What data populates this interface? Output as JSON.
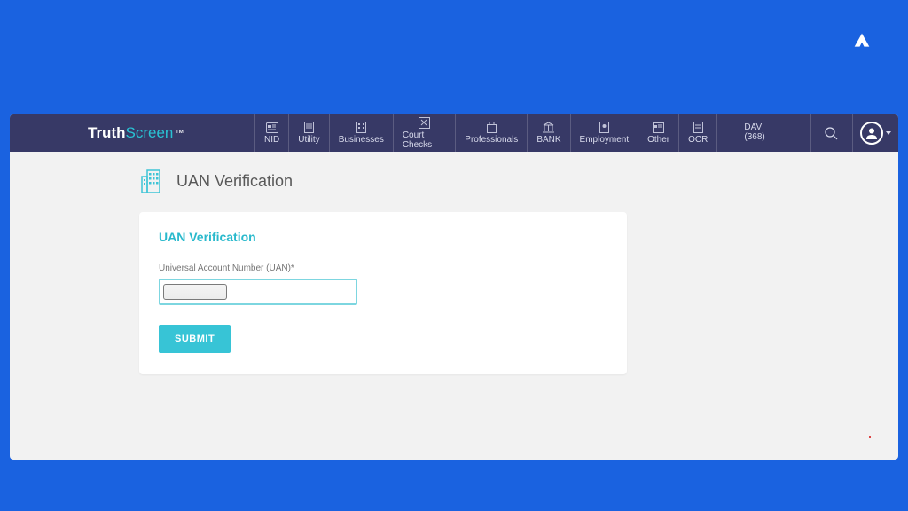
{
  "brand": {
    "part1": "Truth",
    "part2": "Screen",
    "tm": "™"
  },
  "nav": {
    "items": [
      {
        "label": "NID"
      },
      {
        "label": "Utility"
      },
      {
        "label": "Businesses"
      },
      {
        "label": "Court Checks"
      },
      {
        "label": "Professionals"
      },
      {
        "label": "BANK"
      },
      {
        "label": "Employment"
      },
      {
        "label": "Other"
      },
      {
        "label": "OCR"
      }
    ],
    "user": "DAV (368)"
  },
  "page": {
    "title": "UAN Verification"
  },
  "form": {
    "title": "UAN Verification",
    "uan_label": "Universal Account Number (UAN)*",
    "submit_label": "SUBMIT"
  }
}
